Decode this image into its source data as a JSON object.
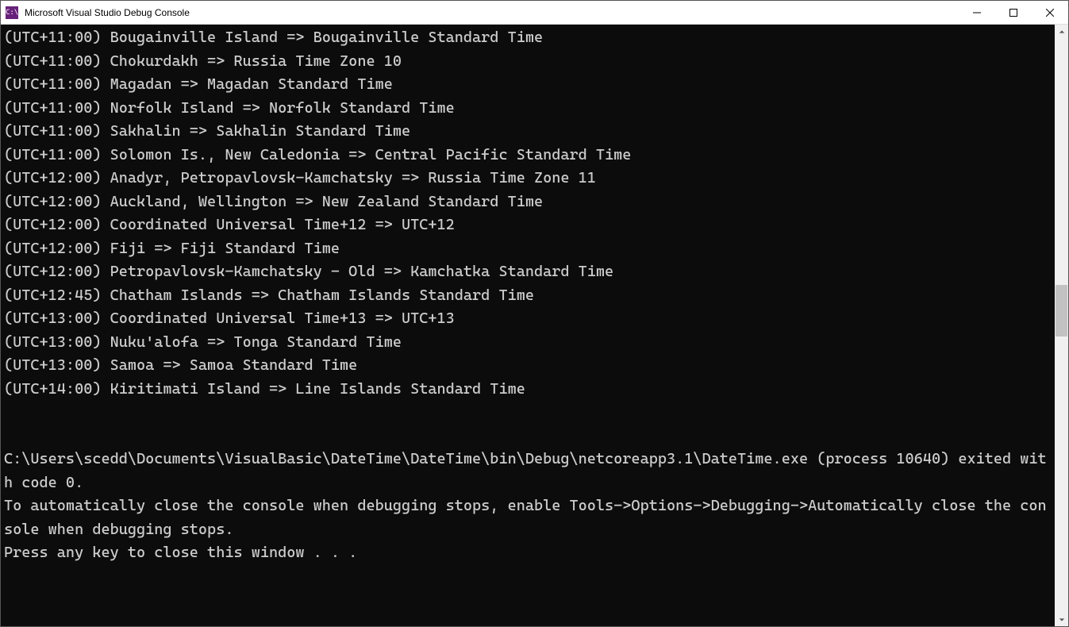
{
  "window": {
    "title": "Microsoft Visual Studio Debug Console",
    "app_icon_text": "C:\\"
  },
  "console": {
    "lines": [
      "(UTC+11:00) Bougainville Island => Bougainville Standard Time",
      "(UTC+11:00) Chokurdakh => Russia Time Zone 10",
      "(UTC+11:00) Magadan => Magadan Standard Time",
      "(UTC+11:00) Norfolk Island => Norfolk Standard Time",
      "(UTC+11:00) Sakhalin => Sakhalin Standard Time",
      "(UTC+11:00) Solomon Is., New Caledonia => Central Pacific Standard Time",
      "(UTC+12:00) Anadyr, Petropavlovsk-Kamchatsky => Russia Time Zone 11",
      "(UTC+12:00) Auckland, Wellington => New Zealand Standard Time",
      "(UTC+12:00) Coordinated Universal Time+12 => UTC+12",
      "(UTC+12:00) Fiji => Fiji Standard Time",
      "(UTC+12:00) Petropavlovsk-Kamchatsky - Old => Kamchatka Standard Time",
      "(UTC+12:45) Chatham Islands => Chatham Islands Standard Time",
      "(UTC+13:00) Coordinated Universal Time+13 => UTC+13",
      "(UTC+13:00) Nuku'alofa => Tonga Standard Time",
      "(UTC+13:00) Samoa => Samoa Standard Time",
      "(UTC+14:00) Kiritimati Island => Line Islands Standard Time",
      "",
      "",
      "C:\\Users\\scedd\\Documents\\VisualBasic\\DateTime\\DateTime\\bin\\Debug\\netcoreapp3.1\\DateTime.exe (process 10640) exited with code 0.",
      "To automatically close the console when debugging stops, enable Tools->Options->Debugging->Automatically close the console when debugging stops.",
      "Press any key to close this window . . ."
    ]
  },
  "scrollbar": {
    "thumb_top_pct": 43,
    "thumb_height_pct": 9
  }
}
